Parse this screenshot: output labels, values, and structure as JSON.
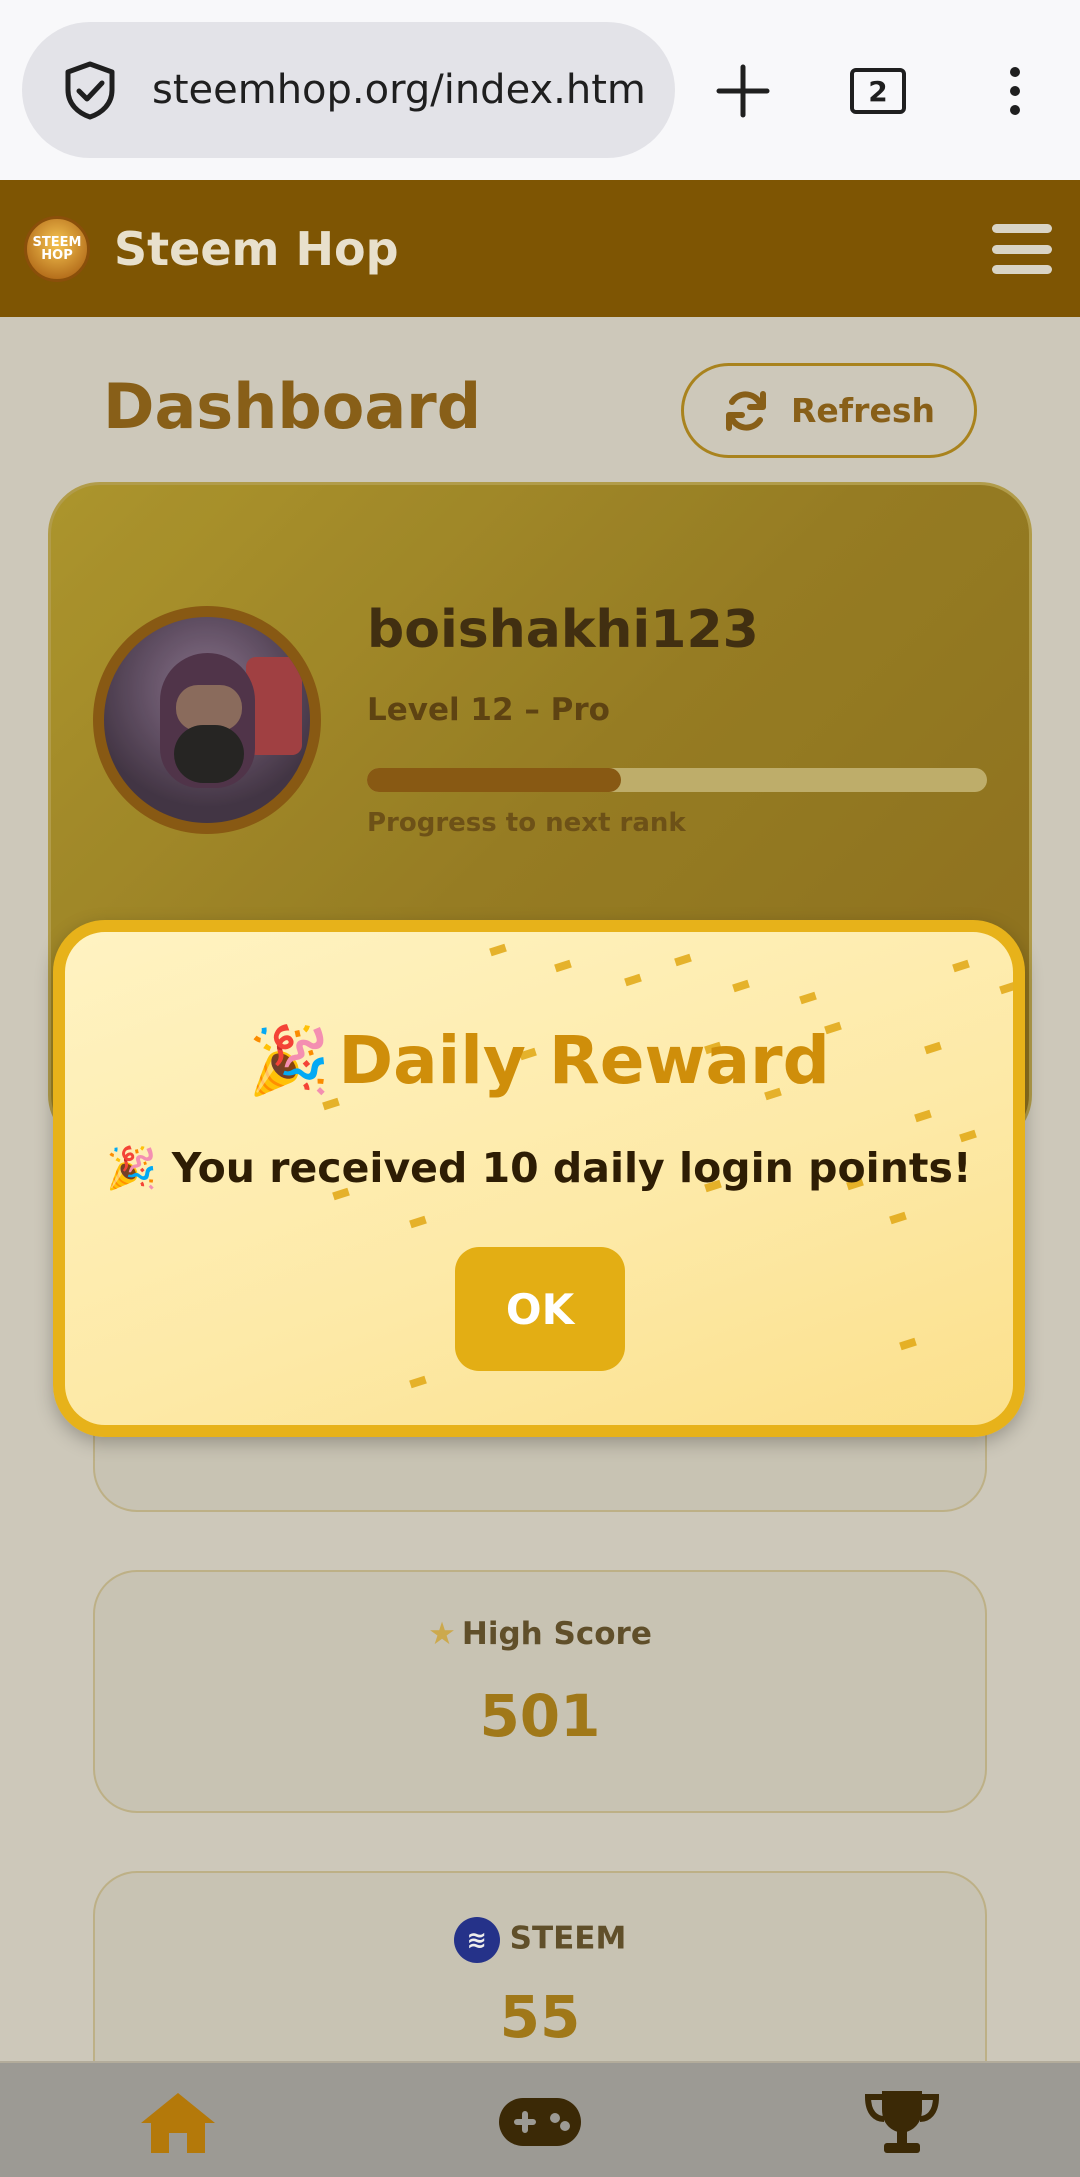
{
  "browser": {
    "url": "steemhop.org/index.htm",
    "tab_count": "2",
    "shield_icon": "shield-check-icon",
    "new_tab_icon": "plus-icon",
    "menu_icon": "more-vert-icon"
  },
  "app": {
    "logo_text": "STEEM HOP",
    "title": "Steem Hop",
    "menu_icon": "hamburger-menu-icon",
    "brand_color": "#7e5503"
  },
  "dashboard": {
    "title": "Dashboard",
    "refresh_label": "Refresh",
    "refresh_icon": "refresh-icon"
  },
  "profile": {
    "username": "boishakhi123",
    "level": "Level 12 – Pro",
    "progress_fraction": 0.41,
    "progress_label": "Progress to next rank"
  },
  "stats": [
    {
      "label": "High Score",
      "value": "501",
      "icon": "star-icon"
    },
    {
      "label": "STEEM",
      "value": "55",
      "icon": "steem-logo-icon"
    }
  ],
  "modal": {
    "title": "Daily Reward",
    "title_emoji": "🎉",
    "message": "🎉 You received 10 daily login points!",
    "ok_label": "OK",
    "accent_color": "#e7b21a"
  },
  "bottom_nav": [
    {
      "name": "home",
      "icon": "home-icon"
    },
    {
      "name": "games",
      "icon": "gamepad-icon"
    },
    {
      "name": "leaderboard",
      "icon": "trophy-icon"
    }
  ]
}
